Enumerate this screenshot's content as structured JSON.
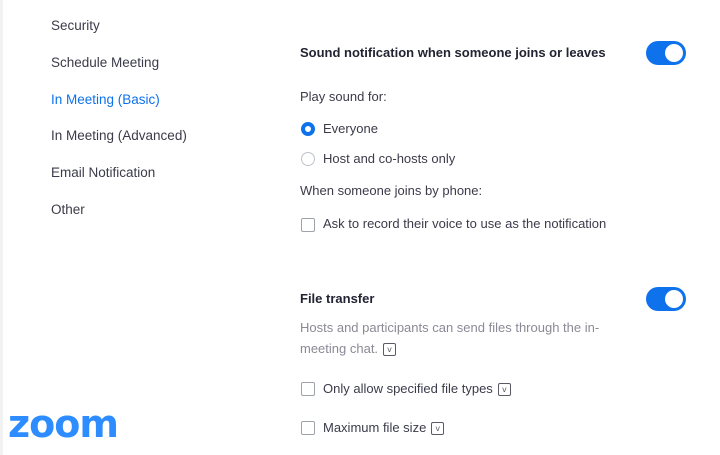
{
  "sidebar": {
    "items": [
      {
        "label": "Security"
      },
      {
        "label": "Schedule Meeting"
      },
      {
        "label": "In Meeting (Basic)"
      },
      {
        "label": "In Meeting (Advanced)"
      },
      {
        "label": "Email Notification"
      },
      {
        "label": "Other"
      }
    ],
    "active_index": 2
  },
  "logo": {
    "text": "zoom",
    "color": "#2D8CFF"
  },
  "sound_notification": {
    "title": "Sound notification when someone joins or leaves",
    "enabled": true,
    "play_sound_label": "Play sound for:",
    "options": [
      {
        "label": "Everyone",
        "selected": true
      },
      {
        "label": "Host and co-hosts only",
        "selected": false
      }
    ],
    "phone_label": "When someone joins by phone:",
    "record_voice_label": "Ask to record their voice to use as the notification",
    "record_voice_checked": false
  },
  "file_transfer": {
    "title": "File transfer",
    "enabled": true,
    "description": "Hosts and participants can send files through the in-meeting chat.",
    "only_specified_types_label": "Only allow specified file types",
    "only_specified_types_checked": false,
    "max_file_size_label": "Maximum file size",
    "max_file_size_checked": false
  },
  "colors": {
    "accent": "#0e72ed",
    "brand": "#2D8CFF"
  },
  "icons": {
    "info": "info-icon"
  }
}
